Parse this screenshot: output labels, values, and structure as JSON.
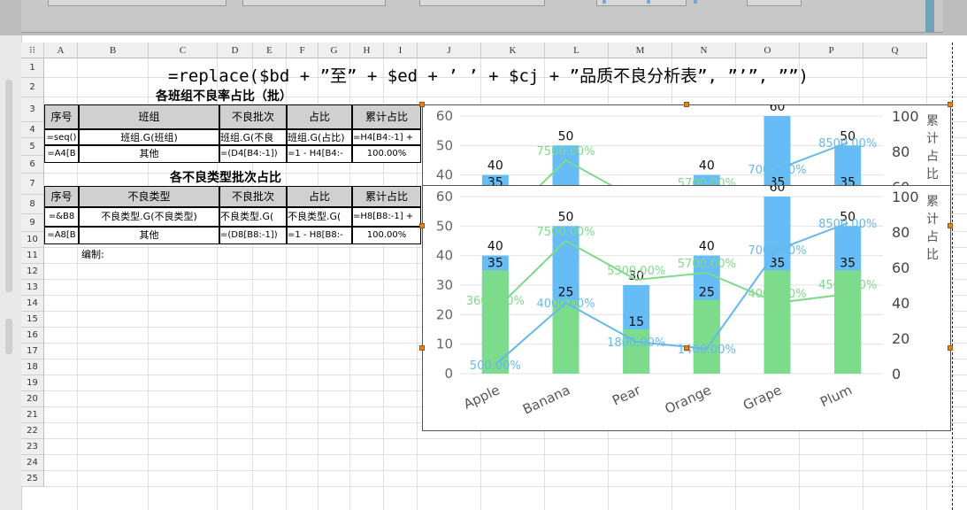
{
  "columns": [
    "A",
    "B",
    "C",
    "D",
    "E",
    "F",
    "G",
    "H",
    "I",
    "J",
    "K",
    "L",
    "M",
    "N",
    "O",
    "P",
    "Q"
  ],
  "rows": [
    "1",
    "2",
    "3",
    "4",
    "5",
    "6",
    "7",
    "8",
    "9",
    "10",
    "11",
    "12",
    "13",
    "14",
    "15",
    "16",
    "17",
    "18",
    "19",
    "20",
    "21",
    "22",
    "23",
    "24",
    "25"
  ],
  "sheet": {
    "formula_title": "=replace($bd + ”至” + $ed + ’ ’ + $cj + ”品质不良分析表”, ”’”, ””)",
    "section1_title": "各班组不良率占比（批）",
    "section1_headers": [
      "序号",
      "班组",
      "不良批次",
      "占比",
      "累计占比"
    ],
    "section1_row4": [
      "=seq()",
      "班组.G(班组)",
      "班组.G(不良",
      "班组.G(占比)",
      "=H4[B4:-1] +"
    ],
    "section1_row5": [
      "=A4[B",
      "其他",
      "=(D4[B4:-1])",
      "=1 - H4[B4:-",
      "100.00%"
    ],
    "section2_title": "各不良类型批次占比",
    "section2_headers": [
      "序号",
      "不良类型",
      "不良批次",
      "占比",
      "累计占比"
    ],
    "section2_row8": [
      "=&B8",
      "不良类型.G(不良类型)",
      "不良类型.G(",
      "不良类型.G(",
      "=H8[B8:-1] +"
    ],
    "section2_row9": [
      "=A8[B",
      "其他",
      "=(D8[B8:-1])",
      "=1 - H8[B8:-",
      "100.00%"
    ],
    "row10_label": "编制:"
  },
  "colors": {
    "green_bar": "#7ddc8c",
    "blue_bar": "#66bdf6",
    "blue_line": "#66b8ec",
    "green_line": "#7fd98a",
    "selection_handle": "#e0841b"
  },
  "chart_data": {
    "type": "bar",
    "categories": [
      "Apple",
      "Banana",
      "Pear",
      "Orange",
      "Grape",
      "Plum"
    ],
    "series": [
      {
        "values": [
          35,
          25,
          15,
          25,
          35,
          35
        ],
        "stack": "green"
      },
      {
        "values": [
          40,
          50,
          30,
          40,
          60,
          50
        ],
        "stack": "blue_total"
      }
    ],
    "line_series": [
      {
        "values": [
          5,
          40,
          18,
          14,
          70,
          85
        ],
        "labels": [
          "500.00%",
          "4000.00%",
          "1800.00%",
          "1400.00%",
          "7000.00%",
          "8500.00%"
        ]
      },
      {
        "values": [
          36,
          75,
          53,
          57,
          40,
          45
        ],
        "labels": [
          "3600.00%",
          "7500.00%",
          "5300.00%",
          "5700.00%",
          "4000.00%",
          "4500.00%"
        ]
      }
    ],
    "ylim": [
      0,
      60
    ],
    "y2lim": [
      0,
      100
    ],
    "yticks": [
      "0",
      "10",
      "20",
      "30",
      "40",
      "50",
      "60"
    ],
    "y2ticks": [
      "0",
      "20",
      "40",
      "60",
      "80",
      "100"
    ],
    "y2label": "累计占比"
  }
}
